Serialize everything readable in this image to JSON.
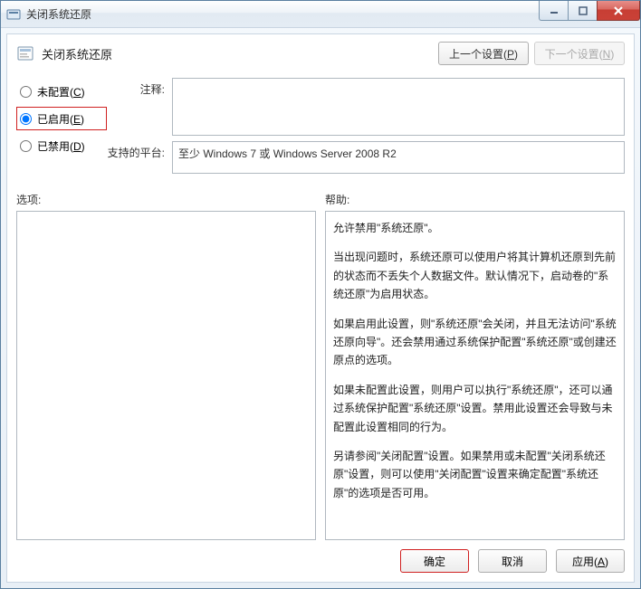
{
  "window": {
    "title": "关闭系统还原"
  },
  "header": {
    "title": "关闭系统还原",
    "prev": "上一个设置(",
    "prev_key": "P",
    "prev_suffix": ")",
    "next": "下一个设置(",
    "next_key": "N",
    "next_suffix": ")"
  },
  "radios": {
    "not_configured": "未配置(",
    "not_configured_key": "C",
    "not_configured_suffix": ")",
    "enabled": "已启用(",
    "enabled_key": "E",
    "enabled_suffix": ")",
    "disabled": "已禁用(",
    "disabled_key": "D",
    "disabled_suffix": ")",
    "selected": "enabled"
  },
  "fields": {
    "comment_label": "注释:",
    "comment_value": "",
    "platform_label": "支持的平台:",
    "platform_value": "至少 Windows 7 或 Windows Server 2008 R2"
  },
  "options": {
    "label": "选项:",
    "value": ""
  },
  "help": {
    "label": "帮助:",
    "paragraphs": [
      "允许禁用\"系统还原\"。",
      "当出现问题时，系统还原可以使用户将其计算机还原到先前的状态而不丢失个人数据文件。默认情况下，启动卷的\"系统还原\"为启用状态。",
      "如果启用此设置，则\"系统还原\"会关闭，并且无法访问\"系统还原向导\"。还会禁用通过系统保护配置\"系统还原\"或创建还原点的选项。",
      "如果未配置此设置，则用户可以执行\"系统还原\"，还可以通过系统保护配置\"系统还原\"设置。禁用此设置还会导致与未配置此设置相同的行为。",
      "另请参阅\"关闭配置\"设置。如果禁用或未配置\"关闭系统还原\"设置，则可以使用\"关闭配置\"设置来确定配置\"系统还原\"的选项是否可用。"
    ]
  },
  "footer": {
    "ok": "确定",
    "cancel": "取消",
    "apply": "应用(",
    "apply_key": "A",
    "apply_suffix": ")"
  }
}
